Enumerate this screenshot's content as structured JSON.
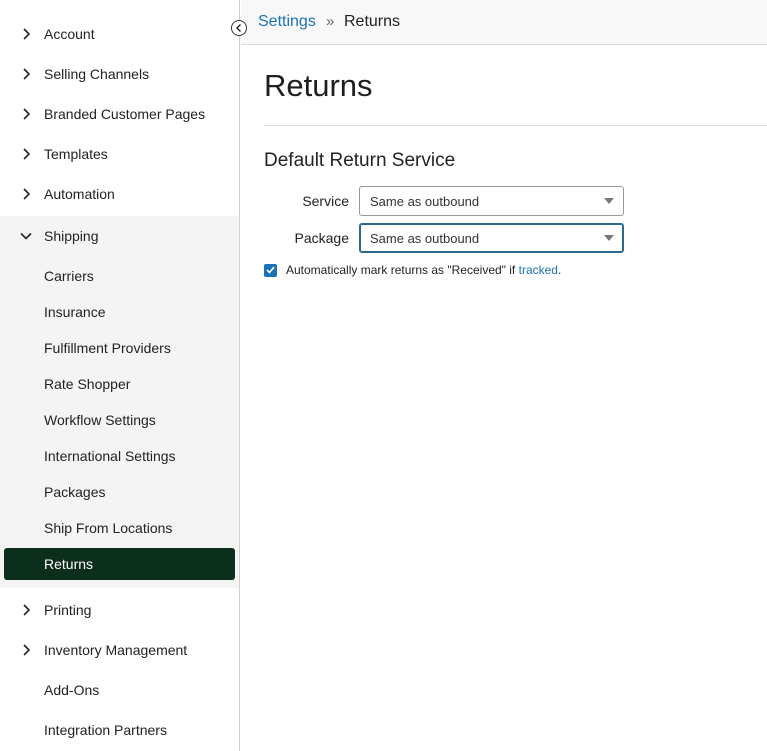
{
  "breadcrumb": {
    "parent": "Settings",
    "separator": "»",
    "current": "Returns"
  },
  "page": {
    "title": "Returns"
  },
  "section": {
    "title": "Default Return Service"
  },
  "form": {
    "service_label": "Service",
    "service_value": "Same as outbound",
    "package_label": "Package",
    "package_value": "Same as outbound",
    "auto_mark_text": "Automatically mark returns as \"Received\" if ",
    "auto_mark_link": "tracked",
    "auto_mark_end": ".",
    "auto_mark_checked": true
  },
  "sidebar": {
    "top_items": [
      {
        "label": "Account",
        "icon": "chevron-right-icon"
      },
      {
        "label": "Selling Channels",
        "icon": "chevron-right-icon"
      },
      {
        "label": "Branded Customer Pages",
        "icon": "chevron-right-icon"
      },
      {
        "label": "Templates",
        "icon": "chevron-right-icon"
      },
      {
        "label": "Automation",
        "icon": "chevron-right-icon"
      },
      {
        "label": "Shipping",
        "icon": "chevron-down-icon"
      }
    ],
    "shipping_sub": [
      "Carriers",
      "Insurance",
      "Fulfillment Providers",
      "Rate Shopper",
      "Workflow Settings",
      "International Settings",
      "Packages",
      "Ship From Locations",
      "Returns"
    ],
    "bottom_items": [
      {
        "label": "Printing",
        "icon": "chevron-right-icon"
      },
      {
        "label": "Inventory Management",
        "icon": "chevron-right-icon"
      },
      {
        "label": "Add-Ons",
        "icon": ""
      },
      {
        "label": "Integration Partners",
        "icon": ""
      }
    ]
  },
  "colors": {
    "accent": "#1a73b8",
    "active_nav": "#0c2e1c",
    "sub_bg": "#f4f4f4"
  }
}
